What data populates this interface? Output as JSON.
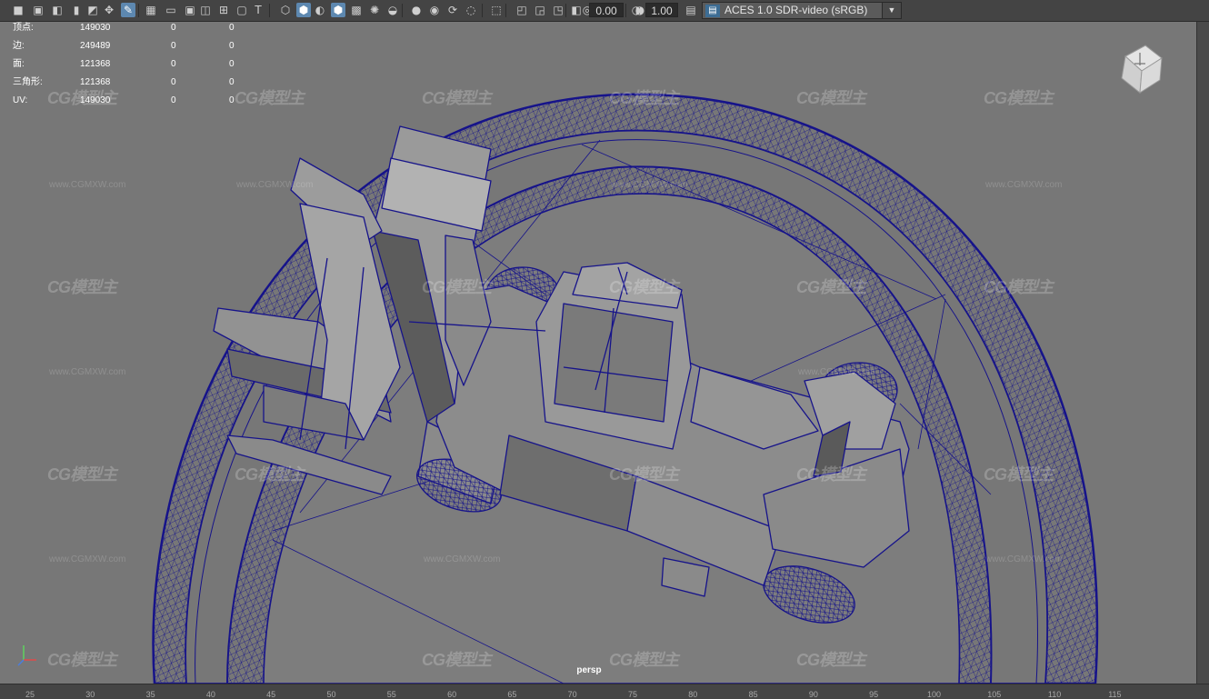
{
  "toolbar": {
    "icons": [
      "camera-icon",
      "camera-attr-icon",
      "bookmark-camera-icon",
      "bookmark-icon",
      "image-plane-icon",
      "2d-pan-zoom-icon",
      "grease-pencil-icon",
      "grid-icon",
      "film-gate-icon",
      "resolution-gate-icon",
      "gate-mask-icon",
      "field-chart-icon",
      "safe-action-icon",
      "safe-title-icon",
      "wireframe-icon",
      "smooth-shade-icon",
      "use-default-material-icon",
      "wireframe-on-shaded-icon",
      "textured-icon",
      "use-lights-icon",
      "shadows-icon",
      "screen-space-ao-icon",
      "motion-blur-icon",
      "multisample-aa-icon",
      "depth-of-field-icon",
      "isolate-select-icon",
      "xray-icon",
      "xray-joints-icon",
      "xray-components-icon",
      "backface-icon",
      "exposure-icon",
      "gamma-icon",
      "color-management-icon"
    ],
    "exposure_value": "0.00",
    "gamma_value": "1.00",
    "color_space": "ACES 1.0 SDR-video (sRGB)"
  },
  "hud": {
    "rows": [
      {
        "label": "顶点:",
        "v1": "149030",
        "v2": "0",
        "v3": "0"
      },
      {
        "label": "边:",
        "v1": "249489",
        "v2": "0",
        "v3": "0"
      },
      {
        "label": "面:",
        "v1": "121368",
        "v2": "0",
        "v3": "0"
      },
      {
        "label": "三角形:",
        "v1": "121368",
        "v2": "0",
        "v3": "0"
      },
      {
        "label": "UV:",
        "v1": "149030",
        "v2": "0",
        "v3": "0"
      }
    ]
  },
  "viewport": {
    "camera_label": "persp",
    "background": "#777777",
    "wire_color": "#16138a"
  },
  "watermark": {
    "logo": "CG模型主",
    "url": "www.CGMXW.com"
  },
  "time_ruler": {
    "ticks": [
      "25",
      "30",
      "35",
      "40",
      "45",
      "50",
      "55",
      "60",
      "65",
      "70",
      "75",
      "80",
      "85",
      "90",
      "95",
      "100",
      "105",
      "110",
      "115"
    ]
  }
}
